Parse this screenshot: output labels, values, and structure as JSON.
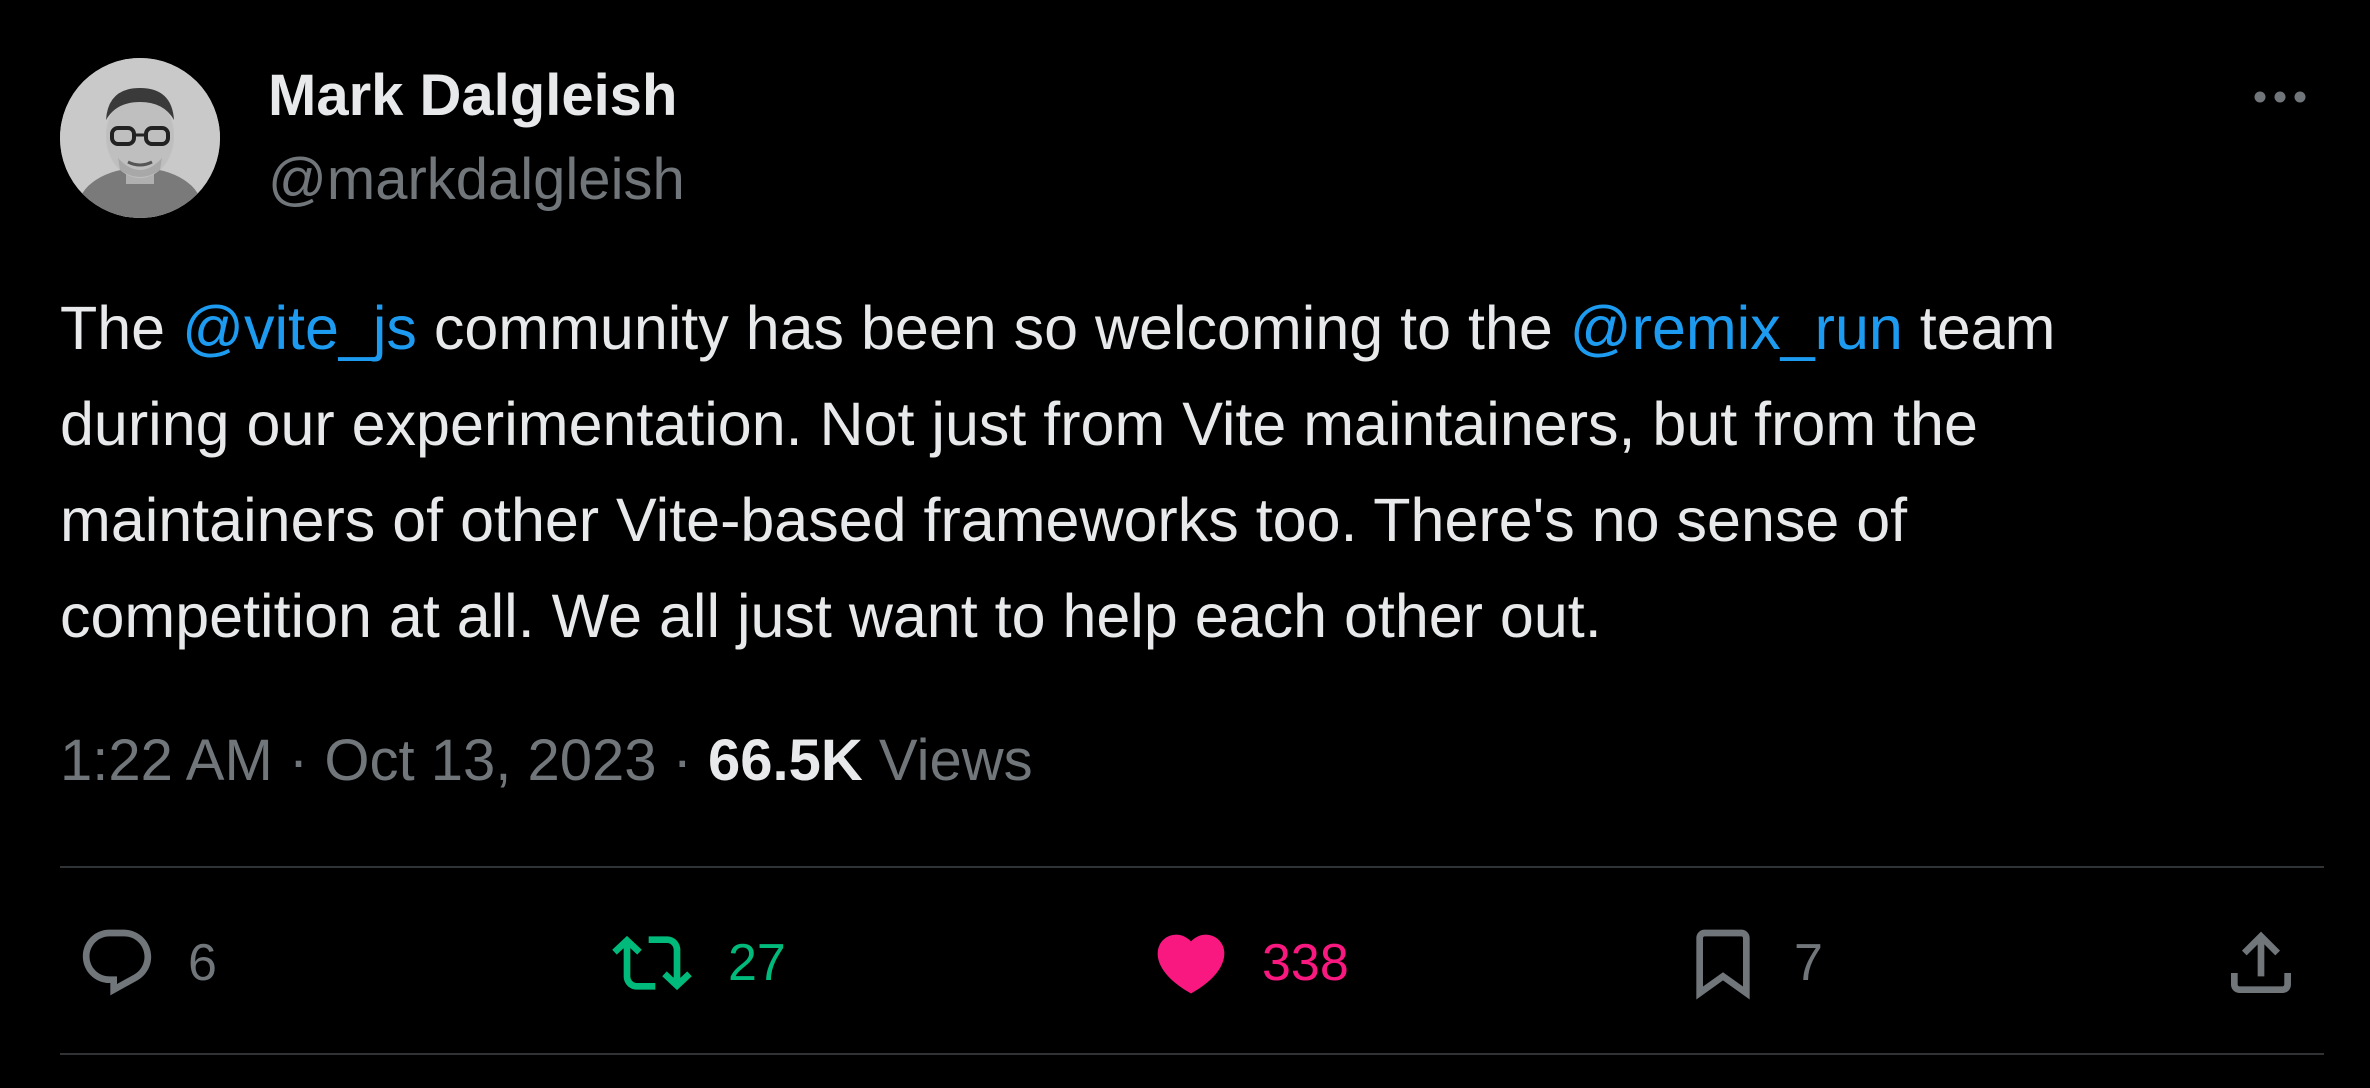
{
  "author": {
    "display_name": "Mark Dalgleish",
    "handle": "@markdalgleish"
  },
  "tweet": {
    "lines": [
      [
        {
          "text": "The ",
          "type": "text"
        },
        {
          "text": "@vite_js",
          "type": "mention"
        },
        {
          "text": " community has been so welcoming to the ",
          "type": "text"
        },
        {
          "text": "@remix_run",
          "type": "mention"
        },
        {
          "text": " team",
          "type": "text"
        }
      ],
      [
        {
          "text": "during our experimentation. Not just from Vite maintainers, but from the",
          "type": "text"
        }
      ],
      [
        {
          "text": "maintainers of other Vite-based frameworks too. There's no sense of",
          "type": "text"
        }
      ],
      [
        {
          "text": "competition at all. We all just want to help each other out.",
          "type": "text"
        }
      ]
    ]
  },
  "meta": {
    "time": "1:22 AM",
    "separator": " · ",
    "date": "Oct 13, 2023",
    "views_count": "66.5K",
    "views_label": " Views"
  },
  "actions": {
    "replies": "6",
    "retweets": "27",
    "likes": "338",
    "bookmarks": "7"
  },
  "icons": {
    "more": "more-horizontal-icon",
    "reply": "speech-bubble-icon",
    "retweet": "retweet-arrows-icon",
    "like": "heart-filled-icon",
    "bookmark": "bookmark-icon",
    "share": "share-upload-icon"
  },
  "colors": {
    "background": "#000000",
    "primary_text": "#e7e9ea",
    "secondary_text": "#71767b",
    "mention": "#1d9bf0",
    "retweet": "#00ba7c",
    "like": "#f91880",
    "divider": "#2f3336"
  }
}
